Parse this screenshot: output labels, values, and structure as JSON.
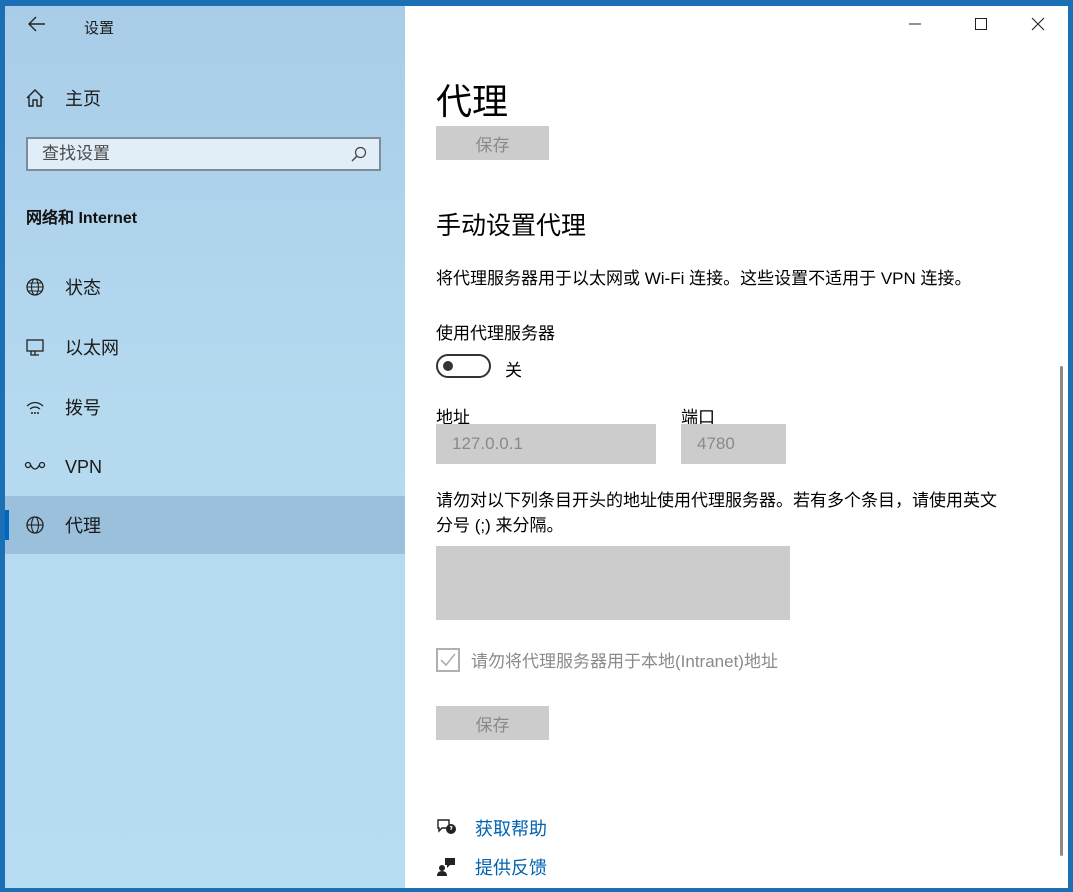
{
  "app": {
    "title": "设置"
  },
  "sidebar": {
    "home_label": "主页",
    "search_placeholder": "查找设置",
    "section_title": "网络和 Internet",
    "items": [
      {
        "label": "状态",
        "icon": "globe-status-icon"
      },
      {
        "label": "以太网",
        "icon": "ethernet-icon"
      },
      {
        "label": "拨号",
        "icon": "dialup-icon"
      },
      {
        "label": "VPN",
        "icon": "vpn-icon"
      },
      {
        "label": "代理",
        "icon": "globe-icon",
        "active": true
      }
    ]
  },
  "main": {
    "page_title": "代理",
    "top_save_label": "保存",
    "manual_heading": "手动设置代理",
    "manual_description": "将代理服务器用于以太网或 Wi-Fi 连接。这些设置不适用于 VPN 连接。",
    "use_proxy_label": "使用代理服务器",
    "toggle_state": "关",
    "address_label": "地址",
    "address_value": "127.0.0.1",
    "port_label": "端口",
    "port_value": "4780",
    "exceptions_description": "请勿对以下列条目开头的地址使用代理服务器。若有多个条目，请使用英文分号 (;) 来分隔。",
    "exceptions_value": "",
    "local_checkbox_label": "请勿将代理服务器用于本地(Intranet)地址",
    "local_checkbox_checked": true,
    "bottom_save_label": "保存",
    "help_link": "获取帮助",
    "feedback_link": "提供反馈"
  },
  "colors": {
    "accent": "#0067c0",
    "link": "#0063b1",
    "disabled_fill": "#cccccc",
    "disabled_text": "#8a8a8a",
    "sidebar_bg": "#b5d9ef",
    "desktop": "#1a6fb5"
  }
}
